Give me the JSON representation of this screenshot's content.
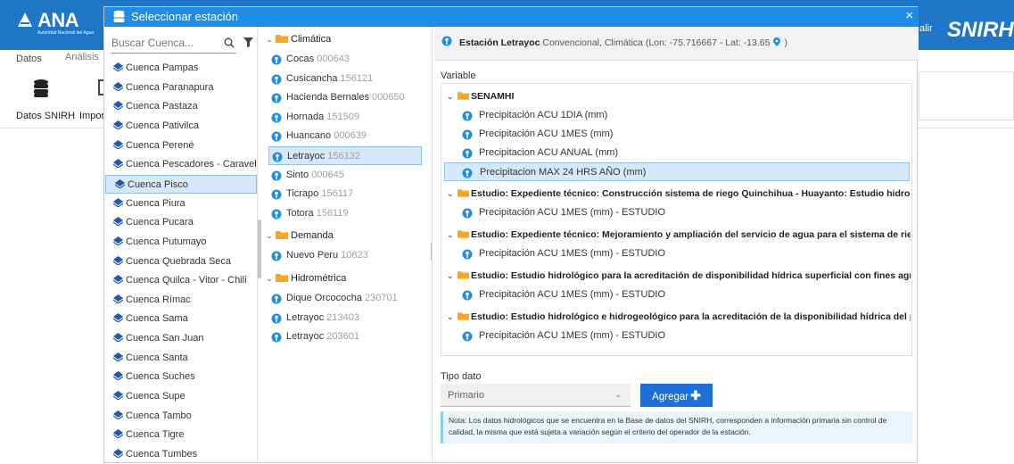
{
  "app": {
    "logo_text": "ANA",
    "logo_subtext": "Autoridad Nacional del Agua",
    "exit_label": "alir",
    "brand_right": "SNIRH",
    "tabs": [
      "Datos",
      "Análisis"
    ],
    "ribbon_buttons": [
      "Datos SNIRH",
      "Import"
    ]
  },
  "modal": {
    "title": "Seleccionar estación",
    "close_label": "×"
  },
  "cuencas": {
    "search_placeholder": "Buscar Cuenca...",
    "items": [
      {
        "label": "Cuenca Pampas"
      },
      {
        "label": "Cuenca Paranapura"
      },
      {
        "label": "Cuenca Pastaza"
      },
      {
        "label": "Cuenca Pativilca"
      },
      {
        "label": "Cuenca Perené"
      },
      {
        "label": "Cuenca Pescadores - Caraveli"
      },
      {
        "label": "Cuenca Pisco",
        "selected": true
      },
      {
        "label": "Cuenca Piura"
      },
      {
        "label": "Cuenca Pucara"
      },
      {
        "label": "Cuenca Putumayo"
      },
      {
        "label": "Cuenca Quebrada Seca"
      },
      {
        "label": "Cuenca Quilca - Vitor - Chili"
      },
      {
        "label": "Cuenca Rímac"
      },
      {
        "label": "Cuenca Sama"
      },
      {
        "label": "Cuenca San Juan"
      },
      {
        "label": "Cuenca Santa"
      },
      {
        "label": "Cuenca Suches"
      },
      {
        "label": "Cuenca Supe"
      },
      {
        "label": "Cuenca Tambo"
      },
      {
        "label": "Cuenca Tigre"
      },
      {
        "label": "Cuenca Tumbes"
      }
    ]
  },
  "estaciones": {
    "groups": [
      {
        "name": "Climática",
        "stations": [
          {
            "name": "Cocas",
            "code": "000643"
          },
          {
            "name": "Cusicancha",
            "code": "156121"
          },
          {
            "name": "Hacienda Bernales",
            "code": "000650"
          },
          {
            "name": "Hornada",
            "code": "151509"
          },
          {
            "name": "Huancano",
            "code": "000639"
          },
          {
            "name": "Letrayoc",
            "code": "156132",
            "selected": true
          },
          {
            "name": "Sinto",
            "code": "000645"
          },
          {
            "name": "Ticrapo",
            "code": "156117"
          },
          {
            "name": "Totora",
            "code": "156119"
          }
        ]
      },
      {
        "name": "Demanda",
        "stations": [
          {
            "name": "Nuevo Peru",
            "code": "10823"
          }
        ]
      },
      {
        "name": "Hidrométrica",
        "stations": [
          {
            "name": "Dique Orcococha",
            "code": "230701"
          },
          {
            "name": "Letrayoc",
            "code": "213403"
          },
          {
            "name": "Letrayoc",
            "code": "203601"
          }
        ]
      }
    ]
  },
  "detalle": {
    "station_name": "Estación Letrayoc",
    "station_meta": "Convencional, Climática (Lon: -75.716667 - Lat: -13.65",
    "station_meta_end": ")",
    "variable_label": "Variable",
    "tree": [
      {
        "group": "SENAMHI",
        "items": [
          {
            "label": "Precipitación ACU 1DIA (mm)"
          },
          {
            "label": "Precipitación ACU 1MES (mm)"
          },
          {
            "label": "Precipitacion ACU ANUAL (mm)"
          },
          {
            "label": "Precipitacion MAX 24 HRS AÑO (mm)",
            "selected": true
          }
        ]
      },
      {
        "group": "Estudio: Expediente técnico: Construcción sistema de riego Quinchihua - Huayanto: Estudio hidrológico p...",
        "items": [
          {
            "label": "Precipitación ACU 1MES (mm) - ESTUDIO"
          }
        ]
      },
      {
        "group": "Estudio: Expediente técnico: Mejoramiento y ampliación del servicio de agua para el sistema de riego Pied...",
        "items": [
          {
            "label": "Precipitación ACU 1MES (mm) - ESTUDIO"
          }
        ]
      },
      {
        "group": "Estudio: Estudio hidrológico para la acreditación de disponibilidad hídrica superficial con fines agricola pa...",
        "items": [
          {
            "label": "Precipitación ACU 1MES (mm) - ESTUDIO"
          }
        ]
      },
      {
        "group": "Estudio: Estudio hidrológico e hidrogeológico para la acreditación de la disponibilidad hídrica del proyect...",
        "items": [
          {
            "label": "Precipitación ACU 1MES (mm) - ESTUDIO"
          }
        ]
      }
    ],
    "tipo_label": "Tipo dato",
    "tipo_value": "Primario",
    "agregar_label": "Agregar",
    "nota": "Nota: Los datos hidrológicos que se encuentra en la Base de datos del SNIRH, corresponden a información primaria sin control de calidad, la misma que está sujeta a variación según el criterio del operador de la estación."
  },
  "colors": {
    "header": "#1f75c6",
    "modal_title": "#1e8de8",
    "selection": "#d6e9fa",
    "button": "#1e70d6",
    "folder": "#f5a623",
    "pin": "#1e8de8"
  }
}
